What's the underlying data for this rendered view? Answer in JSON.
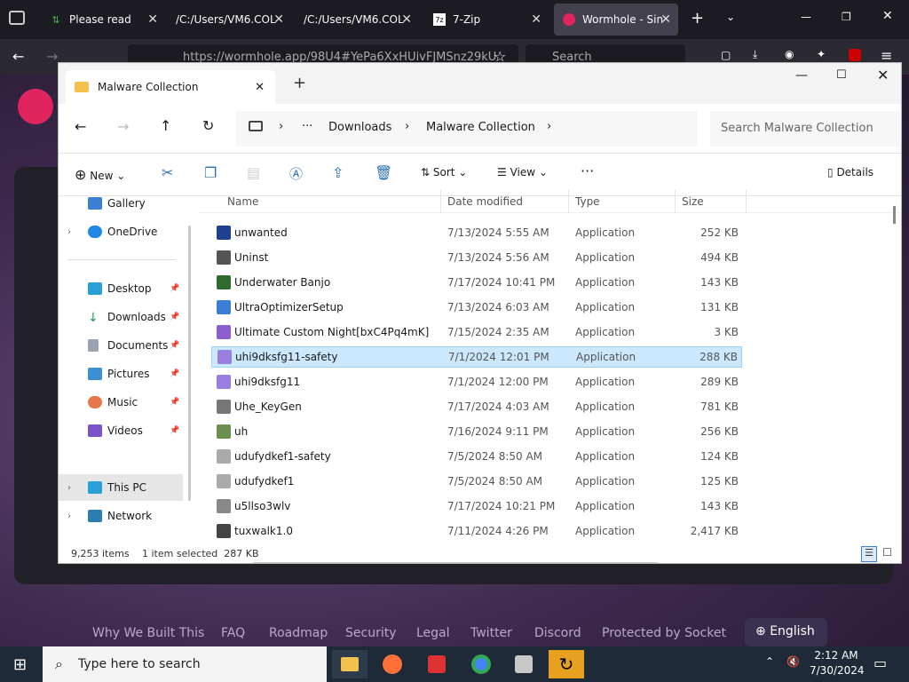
{
  "browser": {
    "tabs": [
      {
        "label": "Please read"
      },
      {
        "label": "/C:/Users/VM6.COL"
      },
      {
        "label": "/C:/Users/VM6.COL"
      },
      {
        "label": "7-Zip"
      },
      {
        "label": "Wormhole - Sin"
      }
    ],
    "url": "https://wormhole.app/98U4#YePa6XxHUivFJMSnz29kU",
    "search_placeholder": "Search"
  },
  "explorer": {
    "tab_title": "Malware Collection",
    "breadcrumb": [
      "Downloads",
      "Malware Collection"
    ],
    "search_placeholder": "Search Malware Collection",
    "cmd": {
      "new": "New",
      "sort": "Sort",
      "view": "View",
      "details": "Details"
    },
    "sidebar": [
      {
        "label": "Gallery"
      },
      {
        "label": "OneDrive"
      },
      {
        "label": "Desktop"
      },
      {
        "label": "Downloads"
      },
      {
        "label": "Documents"
      },
      {
        "label": "Pictures"
      },
      {
        "label": "Music"
      },
      {
        "label": "Videos"
      },
      {
        "label": "This PC"
      },
      {
        "label": "Network"
      }
    ],
    "columns": {
      "name": "Name",
      "date": "Date modified",
      "type": "Type",
      "size": "Size"
    },
    "files": [
      {
        "name": "unwanted",
        "date": "7/13/2024 5:55 AM",
        "type": "Application",
        "size": "252 KB"
      },
      {
        "name": "Uninst",
        "date": "7/13/2024 5:56 AM",
        "type": "Application",
        "size": "494 KB"
      },
      {
        "name": "Underwater Banjo",
        "date": "7/17/2024 10:41 PM",
        "type": "Application",
        "size": "143 KB"
      },
      {
        "name": "UltraOptimizerSetup",
        "date": "7/13/2024 6:03 AM",
        "type": "Application",
        "size": "131 KB"
      },
      {
        "name": "Ultimate Custom Night[bxC4Pq4mK]",
        "date": "7/15/2024 2:35 AM",
        "type": "Application",
        "size": "3 KB"
      },
      {
        "name": "uhi9dksfg11-safety",
        "date": "7/1/2024 12:01 PM",
        "type": "Application",
        "size": "288 KB"
      },
      {
        "name": "uhi9dksfg11",
        "date": "7/1/2024 12:00 PM",
        "type": "Application",
        "size": "289 KB"
      },
      {
        "name": "Uhe_KeyGen",
        "date": "7/17/2024 4:03 AM",
        "type": "Application",
        "size": "781 KB"
      },
      {
        "name": "uh",
        "date": "7/16/2024 9:11 PM",
        "type": "Application",
        "size": "256 KB"
      },
      {
        "name": "udufydkef1-safety",
        "date": "7/5/2024 8:50 AM",
        "type": "Application",
        "size": "124 KB"
      },
      {
        "name": "udufydkef1",
        "date": "7/5/2024 8:50 AM",
        "type": "Application",
        "size": "125 KB"
      },
      {
        "name": "u5llso3wlv",
        "date": "7/17/2024 10:21 PM",
        "type": "Application",
        "size": "143 KB"
      },
      {
        "name": "tuxwalk1.0",
        "date": "7/11/2024 4:26 PM",
        "type": "Application",
        "size": "2,417 KB"
      }
    ],
    "status": {
      "items": "9,253 items",
      "selected": "1 item selected  287 KB"
    }
  },
  "page_links": [
    "Why We Built This",
    "FAQ",
    "Roadmap",
    "Security",
    "Legal",
    "Twitter",
    "Discord",
    "Protected by Socket"
  ],
  "language": "English",
  "taskbar": {
    "search": "Type here to search",
    "time": "2:12 AM",
    "date": "7/30/2024"
  }
}
